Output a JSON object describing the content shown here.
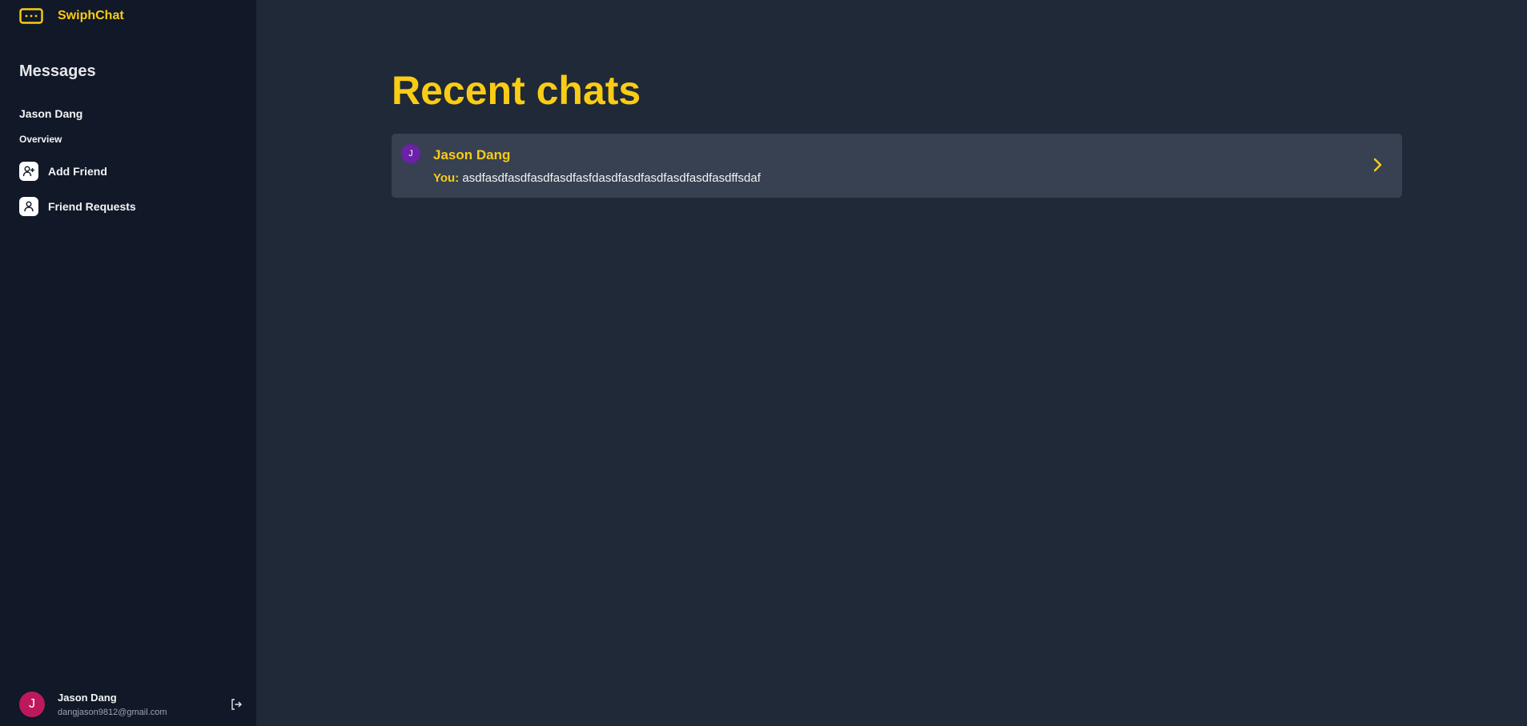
{
  "app": {
    "name": "SwiphChat",
    "accent": "#facc15"
  },
  "sidebar": {
    "logo_icon": "chat-bubble-dots-icon",
    "title": "Messages",
    "friend_name": "Jason Dang",
    "section_label": "Overview",
    "items": [
      {
        "label": "Add Friend",
        "icon": "user-plus-icon"
      },
      {
        "label": "Friend Requests",
        "icon": "user-icon"
      }
    ],
    "user": {
      "initial": "J",
      "name": "Jason Dang",
      "email": "dangjason9812@gmail.com",
      "logout_icon": "logout-icon"
    }
  },
  "main": {
    "title": "Recent chats",
    "chats": [
      {
        "initial": "J",
        "name": "Jason Dang",
        "sender_prefix": "You:",
        "message": "asdfasdfasdfasdfasdfasfdasdfasdfasdfasdfasdfasdffsdaf"
      }
    ]
  }
}
